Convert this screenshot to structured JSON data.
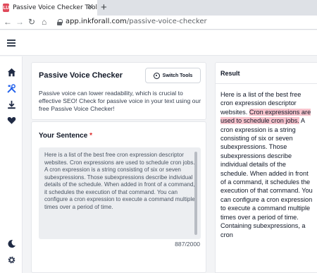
{
  "browser": {
    "tab_title": "Passive Voice Checker Tool",
    "favicon_text": "LU",
    "url_host": "app.inkforall.com",
    "url_path": "/passive-voice-checker"
  },
  "sidebar": {
    "items": [
      {
        "icon": "home-icon"
      },
      {
        "icon": "tools-icon"
      },
      {
        "icon": "download-icon"
      },
      {
        "icon": "heart-icon"
      },
      {
        "icon": "moon-icon"
      },
      {
        "icon": "gear-icon"
      }
    ]
  },
  "tool": {
    "title": "Passive Voice Checker",
    "switch_label": "Switch Tools",
    "description": "Passive voice can lower readability, which is crucial to effective SEO! Check for passive voice in your text using our free Passive Voice Checker!"
  },
  "input": {
    "label": "Your Sentence",
    "required_mark": "*",
    "value": "Here is a list of the best free cron expression descriptor websites. Cron expressions are used to schedule cron jobs. A cron expression is a string consisting of six or seven subexpressions. Those subexpressions describe individual details of the schedule. When added in front of a command, it schedules the execution of that command. You can configure a cron expression to execute a command multiple times over a period of time.",
    "counter": "887/2000"
  },
  "result": {
    "label": "Result",
    "text_before": "Here is a list of the best free cron expression descriptor websites. ",
    "highlight": "Cron expressions are used to schedule cron jobs.",
    "text_after": " A cron expression is a string consisting of six or seven subexpressions. Those subexpressions describe individual details of the schedule. When added in front of a command, it schedules the execution of that command. You can configure a cron expression to execute a command multiple times over a period of time. Containing subexpressions, a cron"
  },
  "colors": {
    "highlight": "#f7c4cd",
    "required": "#dc2626",
    "favicon": "#e04a5b"
  }
}
